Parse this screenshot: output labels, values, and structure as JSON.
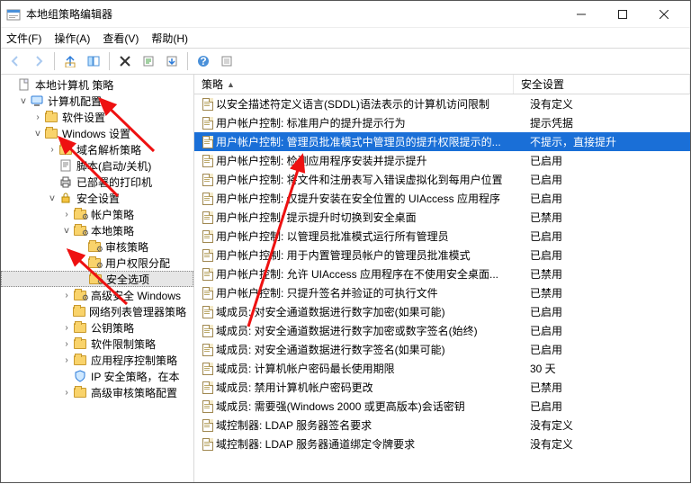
{
  "titlebar": {
    "title": "本地组策略编辑器"
  },
  "menu": {
    "file": "文件(F)",
    "action": "操作(A)",
    "view": "查看(V)",
    "help": "帮助(H)"
  },
  "tree": {
    "root": "本地计算机 策略",
    "computer_config": "计算机配置",
    "software_settings": "软件设置",
    "windows_settings": "Windows 设置",
    "name_resolution": "域名解析策略",
    "scripts": "脚本(启动/关机)",
    "printers": "已部署的打印机",
    "security_settings": "安全设置",
    "account_policies": "帐户策略",
    "local_policies": "本地策略",
    "audit_policy": "审核策略",
    "user_rights": "用户权限分配",
    "security_options": "安全选项",
    "adv_security": "高级安全 Windows",
    "network_list": "网络列表管理器策略",
    "public_key": "公钥策略",
    "software_restriction": "软件限制策略",
    "app_control": "应用程序控制策略",
    "ip_security": "IP 安全策略，在本",
    "adv_audit": "高级审核策略配置"
  },
  "headers": {
    "policy": "策略",
    "setting": "安全设置"
  },
  "list": [
    {
      "name": "以安全描述符定义语言(SDDL)语法表示的计算机访问限制",
      "value": "没有定义"
    },
    {
      "name": "用户帐户控制: 标准用户的提升提示行为",
      "value": "提示凭据"
    },
    {
      "name": "用户帐户控制: 管理员批准模式中管理员的提升权限提示的...",
      "value": "不提示，直接提升",
      "selected": true
    },
    {
      "name": "用户帐户控制: 检测应用程序安装并提示提升",
      "value": "已启用"
    },
    {
      "name": "用户帐户控制: 将文件和注册表写入错误虚拟化到每用户位置",
      "value": "已启用"
    },
    {
      "name": "用户帐户控制: 仅提升安装在安全位置的 UIAccess 应用程序",
      "value": "已启用"
    },
    {
      "name": "用户帐户控制: 提示提升时切换到安全桌面",
      "value": "已禁用"
    },
    {
      "name": "用户帐户控制: 以管理员批准模式运行所有管理员",
      "value": "已启用"
    },
    {
      "name": "用户帐户控制: 用于内置管理员帐户的管理员批准模式",
      "value": "已启用"
    },
    {
      "name": "用户帐户控制: 允许 UIAccess 应用程序在不使用安全桌面...",
      "value": "已禁用"
    },
    {
      "name": "用户帐户控制: 只提升签名并验证的可执行文件",
      "value": "已禁用"
    },
    {
      "name": "域成员: 对安全通道数据进行数字加密(如果可能)",
      "value": "已启用"
    },
    {
      "name": "域成员: 对安全通道数据进行数字加密或数字签名(始终)",
      "value": "已启用"
    },
    {
      "name": "域成员: 对安全通道数据进行数字签名(如果可能)",
      "value": "已启用"
    },
    {
      "name": "域成员: 计算机帐户密码最长使用期限",
      "value": "30 天"
    },
    {
      "name": "域成员: 禁用计算机帐户密码更改",
      "value": "已禁用"
    },
    {
      "name": "域成员: 需要强(Windows 2000 或更高版本)会话密钥",
      "value": "已启用"
    },
    {
      "name": "域控制器: LDAP 服务器签名要求",
      "value": "没有定义"
    },
    {
      "name": "域控制器: LDAP 服务器通道绑定令牌要求",
      "value": "没有定义"
    }
  ]
}
